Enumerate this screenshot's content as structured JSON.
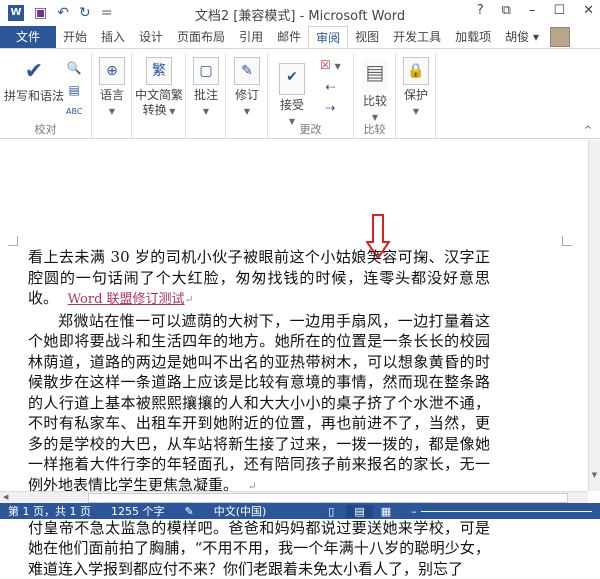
{
  "window": {
    "title": "文档2 [兼容模式] - Microsoft Word",
    "help": "?",
    "restore_ribbon": "⧉",
    "minimize": "–",
    "maximize": "☐",
    "close": "✕"
  },
  "quick_access": {
    "app_icon": "W",
    "save": "save-icon",
    "undo": "↶",
    "redo": "↻",
    "customize": "="
  },
  "tabs": [
    {
      "label": "文件"
    },
    {
      "label": "开始"
    },
    {
      "label": "插入"
    },
    {
      "label": "设计"
    },
    {
      "label": "页面布局"
    },
    {
      "label": "引用"
    },
    {
      "label": "邮件"
    },
    {
      "label": "审阅",
      "active": true
    },
    {
      "label": "视图"
    },
    {
      "label": "开发工具"
    },
    {
      "label": "加载项"
    }
  ],
  "user": {
    "name": "胡俊 ▾"
  },
  "ribbon": {
    "proofing": {
      "spelling": "拼写和语法",
      "group": "校对"
    },
    "language": "语言",
    "chinese": {
      "line1": "中文简繁",
      "line2": "转换"
    },
    "comments": "批注",
    "tracking": "修订",
    "changes": {
      "accept": "接受",
      "group": "更改"
    },
    "compare": {
      "compare": "比较",
      "group": "比较"
    },
    "protect": "保护",
    "collapse": "^"
  },
  "document": {
    "paragraphs": [
      {
        "text": "看上去未满 30 岁的司机小伙子被眼前这个小姑娘笑容可掬、汉字正腔圆的一句话闹了个大红脸，匆匆找钱的时候，连零头都没好意思收。",
        "revision": "Word 联盟修订测试",
        "indent": false
      },
      {
        "text": "郑微站在惟一可以遮荫的大树下，一边用手扇风，一边打量着这个她即将要战斗和生活四年的地方。她所在的位置是一条长长的校园林荫道，道路的两边是她叫不出名的亚热带树木，可以想象黄昏的时候散步在这样一条道路上应该是比较有意境的事情，然而现在整条路的人行道上基本被熙熙攘攘的人和大大小小的桌子挤了个水泄不通，不时有私家车、出租车开到她附近的位置，再也前进不了，当然，更多的是学校的大巴，从车站将新生接了过来，一拨一拨的，都是像她一样拖着大件行李的年轻面孔，还有陪同孩子前来报名的家长，无一例外地表情比学生更焦急凝重。",
        "indent": true
      },
      {
        "text": "郑微看着他们就笑了，她想，要是她妈妈跟着来了，应该也是这付皇帝不急太监急的模样吧。爸爸和妈妈都说过要送她来学校，可是她在他们面前拍了胸脯，“不用不用，我一个年满十八岁的聪明少女，难道连入学报到都应付不来？你们老跟着未免太小看人了，别忘了",
        "indent": true
      }
    ],
    "paragraph_mark": "↵"
  },
  "status": {
    "page": "第 1 页，共 1 页",
    "words": "1255 个字",
    "language": "中文(中国)"
  },
  "colors": {
    "accent": "#2b579a",
    "revision": "#b03060",
    "arrow": "#e02020"
  }
}
